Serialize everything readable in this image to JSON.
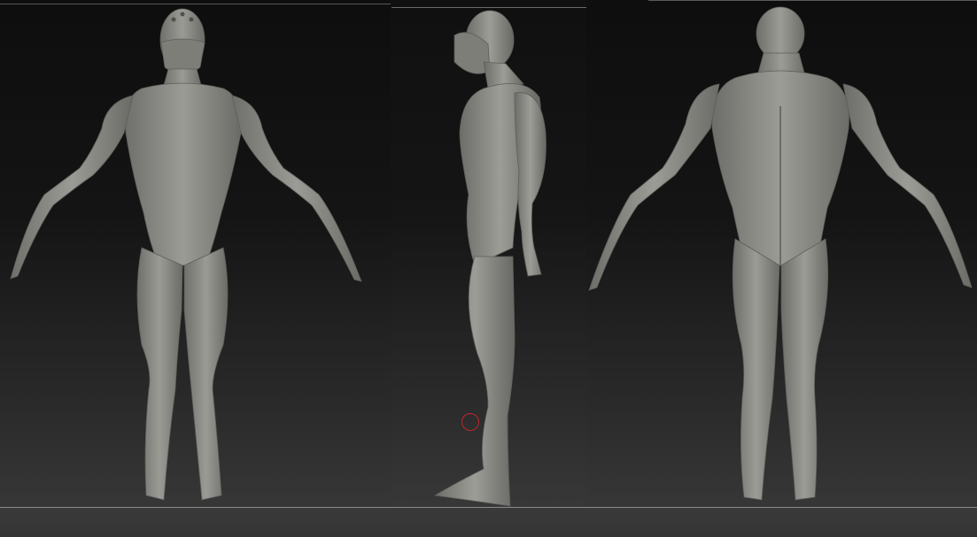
{
  "viewport": {
    "background_color": "#1a1a1a",
    "model_color": "#8f908a",
    "views": [
      {
        "name": "front"
      },
      {
        "name": "side"
      },
      {
        "name": "back"
      }
    ]
  },
  "cursor": {
    "icon": "brush-circle-icon",
    "color": "#c0262b"
  }
}
